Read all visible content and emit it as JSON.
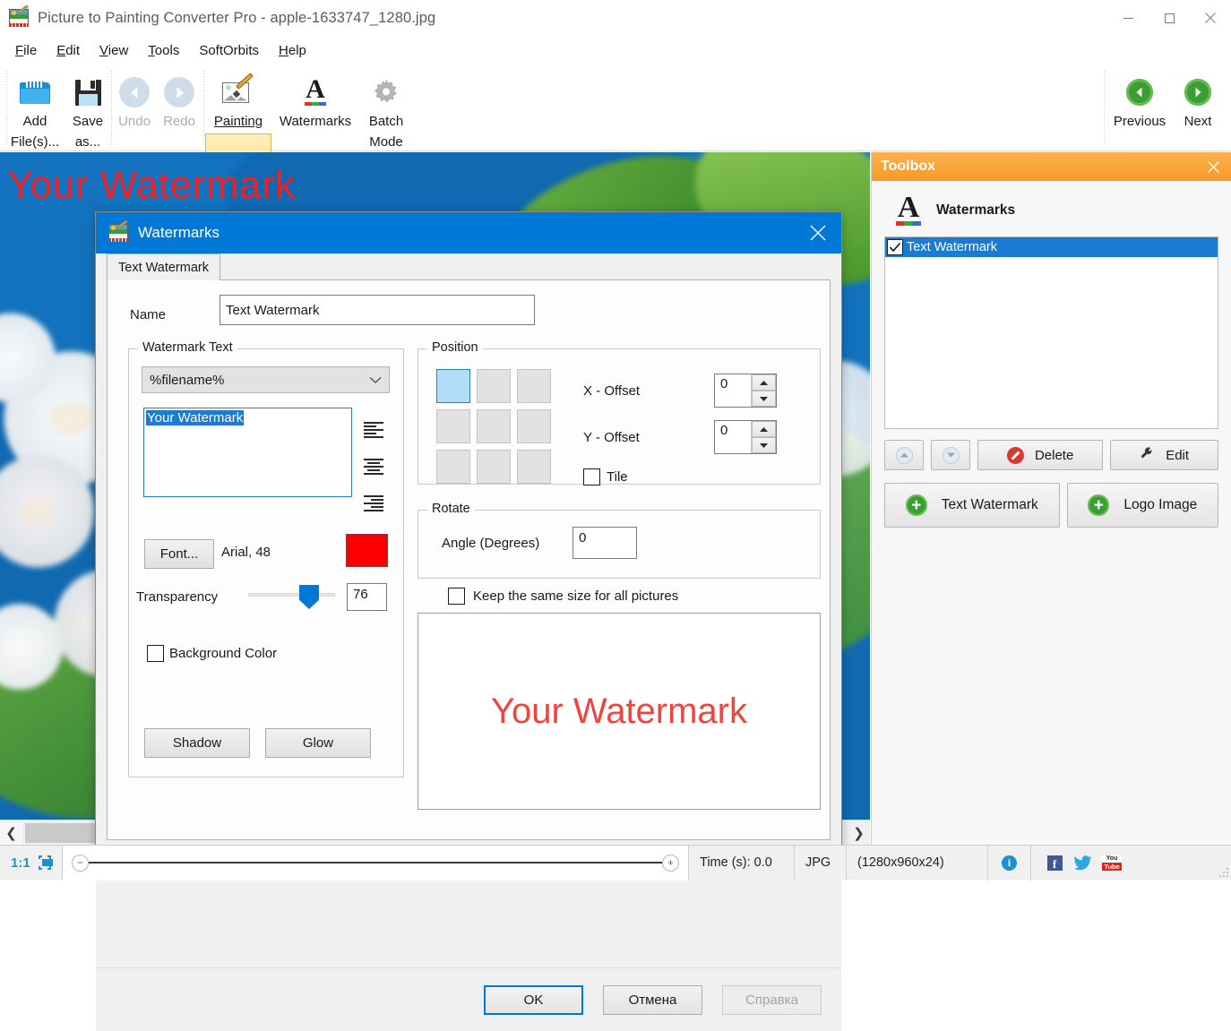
{
  "window": {
    "title": "Picture to Painting Converter Pro - apple-1633747_1280.jpg",
    "app_icon": "picture-painting-icon",
    "minimize": "minimize-icon",
    "maximize": "maximize-icon",
    "close": "close-icon"
  },
  "menubar": {
    "items": [
      {
        "label": "File",
        "accel": "F"
      },
      {
        "label": "Edit",
        "accel": "E"
      },
      {
        "label": "View",
        "accel": "V"
      },
      {
        "label": "Tools",
        "accel": "T"
      },
      {
        "label": "SoftOrbits",
        "accel": ""
      },
      {
        "label": "Help",
        "accel": "H"
      }
    ]
  },
  "toolbar": {
    "items": [
      {
        "name": "add-files",
        "line1": "Add",
        "line2": "File(s)...",
        "icon": "folder-icon",
        "enabled": true
      },
      {
        "name": "save-as",
        "line1": "Save",
        "line2": "as...",
        "icon": "floppy-disk-icon",
        "enabled": true
      },
      {
        "name": "undo",
        "line1": "Undo",
        "line2": "",
        "icon": "undo-arrow-icon",
        "enabled": false
      },
      {
        "name": "redo",
        "line1": "Redo",
        "line2": "",
        "icon": "redo-arrow-icon",
        "enabled": false
      },
      {
        "name": "painting",
        "line1": "Painting",
        "line2": "",
        "icon": "painting-icon",
        "enabled": true,
        "active": true
      },
      {
        "name": "watermarks",
        "line1": "Watermarks",
        "line2": "",
        "icon": "letter-a-icon",
        "enabled": true
      },
      {
        "name": "batch-mode",
        "line1": "Batch",
        "line2": "Mode",
        "icon": "gear-icon",
        "enabled": true
      }
    ],
    "nav": [
      {
        "name": "previous",
        "label": "Previous",
        "icon": "arrow-left-circle-icon"
      },
      {
        "name": "next",
        "label": "Next",
        "icon": "arrow-right-circle-icon"
      }
    ],
    "overflow": "chevron-down-icon"
  },
  "canvas": {
    "watermark_overlay_text": "Your Watermark",
    "watermark_color": "#ff1a1a",
    "scroll_left_icon": "chevron-left-icon",
    "scroll_right_icon": "chevron-right-icon"
  },
  "toolbox": {
    "header_title": "Toolbox",
    "close_icon": "close-icon",
    "section_icon": "letter-a-icon",
    "section_title": "Watermarks",
    "list": [
      {
        "label": "Text Watermark",
        "checked": true,
        "selected": true
      }
    ],
    "buttons": {
      "move_up": "chevron-up-icon",
      "move_down": "chevron-down-icon",
      "delete": "Delete",
      "delete_icon": "forbidden-icon",
      "edit": "Edit",
      "edit_icon": "wrench-icon",
      "add_text_watermark": "Text Watermark",
      "add_logo_image": "Logo Image",
      "plus_icon": "plus-circle-icon"
    }
  },
  "dialog": {
    "title": "Watermarks",
    "icon": "picture-painting-icon",
    "close_icon": "close-icon",
    "tab": "Text Watermark",
    "name_label": "Name",
    "name_value": "Text Watermark",
    "watermark_text": {
      "group_title": "Watermark Text",
      "macro_selected": "%filename%",
      "dropdown_icon": "chevron-down-icon",
      "text_value": "Your Watermark",
      "align_left_icon": "align-left-icon",
      "align_center_icon": "align-center-icon",
      "align_right_icon": "align-right-icon",
      "font_button": "Font...",
      "font_value": "Arial, 48",
      "color_swatch": "#fb0000",
      "transparency_label": "Transparency",
      "transparency_value": "76",
      "background_color_label": "Background Color",
      "background_color_checked": false,
      "shadow_button": "Shadow",
      "glow_button": "Glow"
    },
    "position": {
      "group_title": "Position",
      "selected_cell": 0,
      "x_offset_label": "X - Offset",
      "x_offset_value": "0",
      "y_offset_label": "Y - Offset",
      "y_offset_value": "0",
      "tile_label": "Tile",
      "tile_checked": false
    },
    "rotate": {
      "group_title": "Rotate",
      "angle_label": "Angle (Degrees)",
      "angle_value": "0"
    },
    "keep_size_label": "Keep the same size for all pictures",
    "keep_size_checked": false,
    "preview_text": "Your Watermark",
    "preview_color": "#ee4540",
    "footer": {
      "ok": "OK",
      "cancel": "Отмена",
      "help": "Справка",
      "help_enabled": false
    }
  },
  "statusbar": {
    "zoom_ratio": "1:1",
    "fit_icon": "fit-to-screen-icon",
    "zoom_out_icon": "minus-circle-icon",
    "zoom_in_icon": "plus-circle-icon",
    "time": "Time (s): 0.0",
    "format": "JPG",
    "dimensions": "(1280x960x24)",
    "info_icon": "info-icon",
    "facebook_icon": "facebook-icon",
    "twitter_icon": "twitter-icon",
    "youtube_icon": "youtube-icon"
  }
}
